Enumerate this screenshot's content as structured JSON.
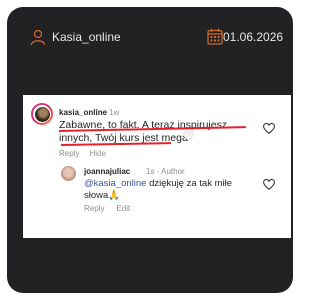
{
  "header": {
    "username": "Kasia_online",
    "date": "01.06.2026",
    "icons": [
      "user-icon",
      "calendar-icon"
    ]
  },
  "comment": {
    "author": "kasia_online",
    "time": "1w",
    "text": "Zabawne, to fakt. A teraz inspirujesz innych, Twój kurs jest mega",
    "emoji": "🤍",
    "actions": {
      "reply": "Reply",
      "hide": "Hide"
    }
  },
  "reply": {
    "author": "joannajuliac",
    "meta": "1s · Author",
    "mention": "@kasia_online",
    "text": "dziękuję za tak miłe słowa",
    "emoji": "🙏",
    "actions": {
      "reply": "Reply",
      "edit": "Edit"
    }
  },
  "colors": {
    "frame": "#222123",
    "underline": "#e8202a",
    "mention": "#385898"
  }
}
